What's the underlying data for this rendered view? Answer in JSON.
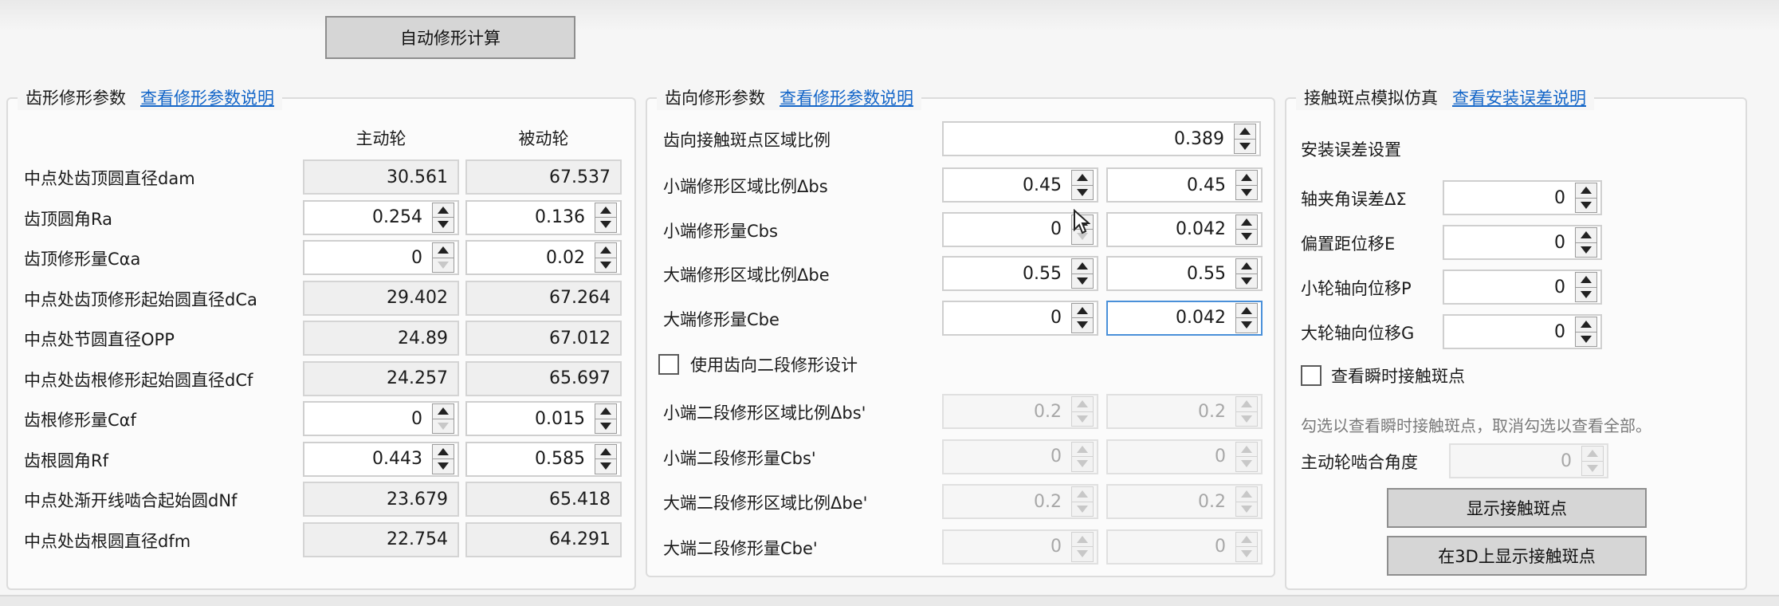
{
  "toolbar": {
    "auto_calc_label": "自动修形计算"
  },
  "profile_group": {
    "title": "齿形修形参数",
    "help_link": "查看修形参数说明",
    "col_drive": "主动轮",
    "col_driven": "被动轮",
    "rows": [
      {
        "label": "中点处齿顶圆直径dam",
        "drive": "30.561",
        "driven": "67.537"
      },
      {
        "label": "齿顶圆角Ra",
        "drive": "0.254",
        "driven": "0.136"
      },
      {
        "label": "齿顶修形量Cαa",
        "drive": "0",
        "driven": "0.02"
      },
      {
        "label": "中点处齿顶修形起始圆直径dCa",
        "drive": "29.402",
        "driven": "67.264"
      },
      {
        "label": "中点处节圆直径OPP",
        "drive": "24.89",
        "driven": "67.012"
      },
      {
        "label": "中点处齿根修形起始圆直径dCf",
        "drive": "24.257",
        "driven": "65.697"
      },
      {
        "label": "齿根修形量Cαf",
        "drive": "0",
        "driven": "0.015"
      },
      {
        "label": "齿根圆角Rf",
        "drive": "0.443",
        "driven": "0.585"
      },
      {
        "label": "中点处渐开线啮合起始圆dNf",
        "drive": "23.679",
        "driven": "65.418"
      },
      {
        "label": "中点处齿根圆直径dfm",
        "drive": "22.754",
        "driven": "64.291"
      }
    ]
  },
  "lead_group": {
    "title": "齿向修形参数",
    "help_link": "查看修形参数说明",
    "contact_ratio_label": "齿向接触斑点区域比例",
    "contact_ratio_value": "0.389",
    "rows": [
      {
        "label": "小端修形区域比例Δbs",
        "a": "0.45",
        "b": "0.45"
      },
      {
        "label": "小端修形量Cbs",
        "a": "0",
        "b": "0.042"
      },
      {
        "label": "大端修形区域比例Δbe",
        "a": "0.55",
        "b": "0.55"
      },
      {
        "label": "大端修形量Cbe",
        "a": "0",
        "b": "0.042"
      }
    ],
    "two_stage_checkbox": "使用齿向二段修形设计",
    "two_stage_rows": [
      {
        "label": "小端二段修形区域比例Δbs'",
        "a": "0.2",
        "b": "0.2"
      },
      {
        "label": "小端二段修形量Cbs'",
        "a": "0",
        "b": "0"
      },
      {
        "label": "大端二段修形区域比例Δbe'",
        "a": "0.2",
        "b": "0.2"
      },
      {
        "label": "大端二段修形量Cbe'",
        "a": "0",
        "b": "0"
      }
    ]
  },
  "contact_group": {
    "title": "接触斑点模拟仿真",
    "help_link": "查看安装误差说明",
    "install_error_heading": "安装误差设置",
    "rows": [
      {
        "label": "轴夹角误差ΔΣ",
        "value": "0"
      },
      {
        "label": "偏置距位移E",
        "value": "0"
      },
      {
        "label": "小轮轴向位移P",
        "value": "0"
      },
      {
        "label": "大轮轴向位移G",
        "value": "0"
      }
    ],
    "instant_checkbox": "查看瞬时接触斑点",
    "hint": "勾选以查看瞬时接触斑点，取消勾选以查看全部。",
    "mesh_angle_label": "主动轮啮合角度",
    "mesh_angle_value": "0",
    "show_button": "显示接触斑点",
    "show_3d_button": "在3D上显示接触斑点"
  },
  "icons": [
    "spin-up-icon",
    "spin-down-icon",
    "checkbox-icon",
    "cursor-icon"
  ]
}
